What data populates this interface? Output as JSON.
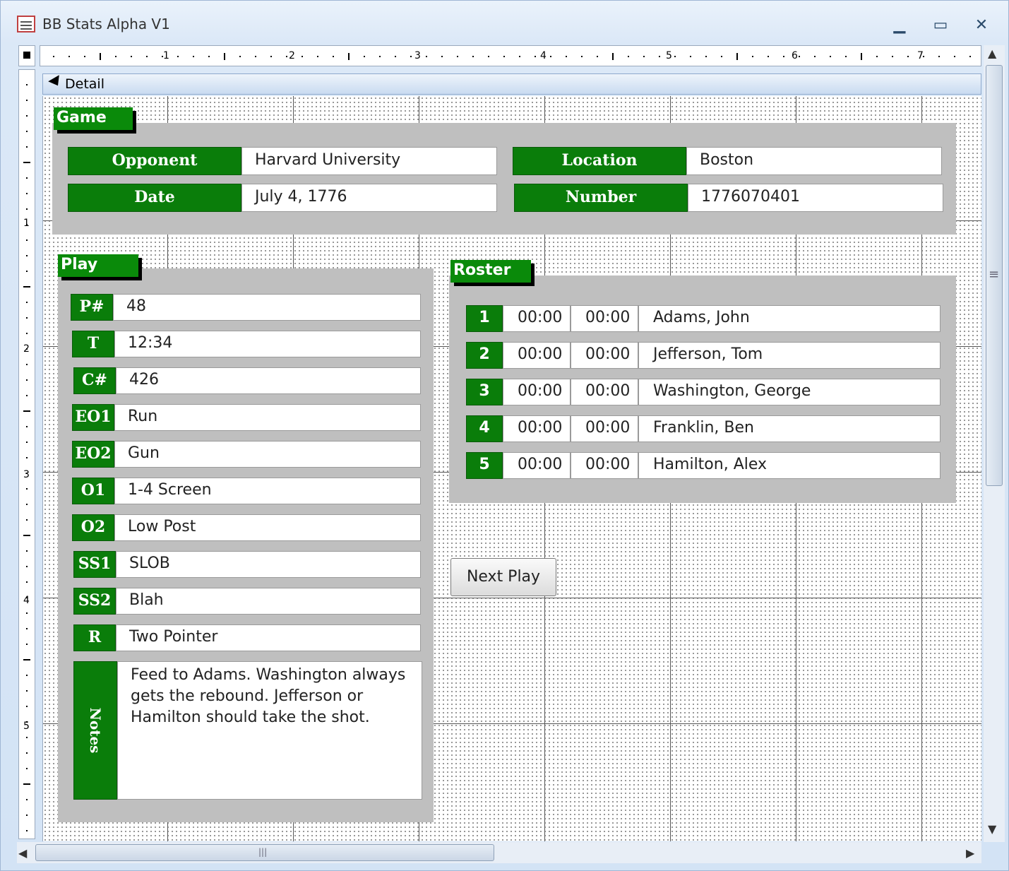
{
  "window": {
    "title": "BB Stats Alpha V1",
    "minimize_glyph": "▁",
    "maximize_glyph": "▭",
    "close_glyph": "✕"
  },
  "ruler": {
    "top_numbers": [
      "1",
      "2",
      "3",
      "4",
      "5",
      "6",
      "7"
    ],
    "left_numbers": [
      "1",
      "2",
      "3",
      "4",
      "5"
    ]
  },
  "section": {
    "label": "Detail"
  },
  "game": {
    "tab_label": "Game",
    "opponent_label": "Opponent",
    "opponent_value": "Harvard University",
    "location_label": "Location",
    "location_value": "Boston",
    "date_label": "Date",
    "date_value": "July 4, 1776",
    "number_label": "Number",
    "number_value": "1776070401"
  },
  "play": {
    "tab_label": "Play",
    "fields": [
      {
        "label": "P#",
        "value": "48"
      },
      {
        "label": "T",
        "value": "12:34"
      },
      {
        "label": "C#",
        "value": "426"
      },
      {
        "label": "EO1",
        "value": "Run"
      },
      {
        "label": "EO2",
        "value": "Gun"
      },
      {
        "label": "O1",
        "value": "1-4 Screen"
      },
      {
        "label": "O2",
        "value": "Low Post"
      },
      {
        "label": "SS1",
        "value": "SLOB"
      },
      {
        "label": "SS2",
        "value": "Blah"
      },
      {
        "label": "R",
        "value": "Two Pointer"
      }
    ],
    "notes_label": "Notes",
    "notes_value": "Feed to Adams.  Washington always gets the rebound.  Jefferson or Hamilton should take the shot."
  },
  "roster": {
    "tab_label": "Roster",
    "rows": [
      {
        "num": "1",
        "t1": "00:00",
        "t2": "00:00",
        "name": "Adams, John"
      },
      {
        "num": "2",
        "t1": "00:00",
        "t2": "00:00",
        "name": "Jefferson, Tom"
      },
      {
        "num": "3",
        "t1": "00:00",
        "t2": "00:00",
        "name": "Washington, George"
      },
      {
        "num": "4",
        "t1": "00:00",
        "t2": "00:00",
        "name": "Franklin, Ben"
      },
      {
        "num": "5",
        "t1": "00:00",
        "t2": "00:00",
        "name": "Hamilton, Alex"
      }
    ]
  },
  "buttons": {
    "next_play": "Next Play"
  },
  "scrollbar": {
    "up_glyph": "▲",
    "down_glyph": "▼",
    "left_glyph": "◀",
    "right_glyph": "▶",
    "grip_glyph": "≡",
    "hgrip_glyph": "|||"
  },
  "colors": {
    "label_green": "#0a7d0a",
    "panel_gray": "#bfbfbf"
  }
}
